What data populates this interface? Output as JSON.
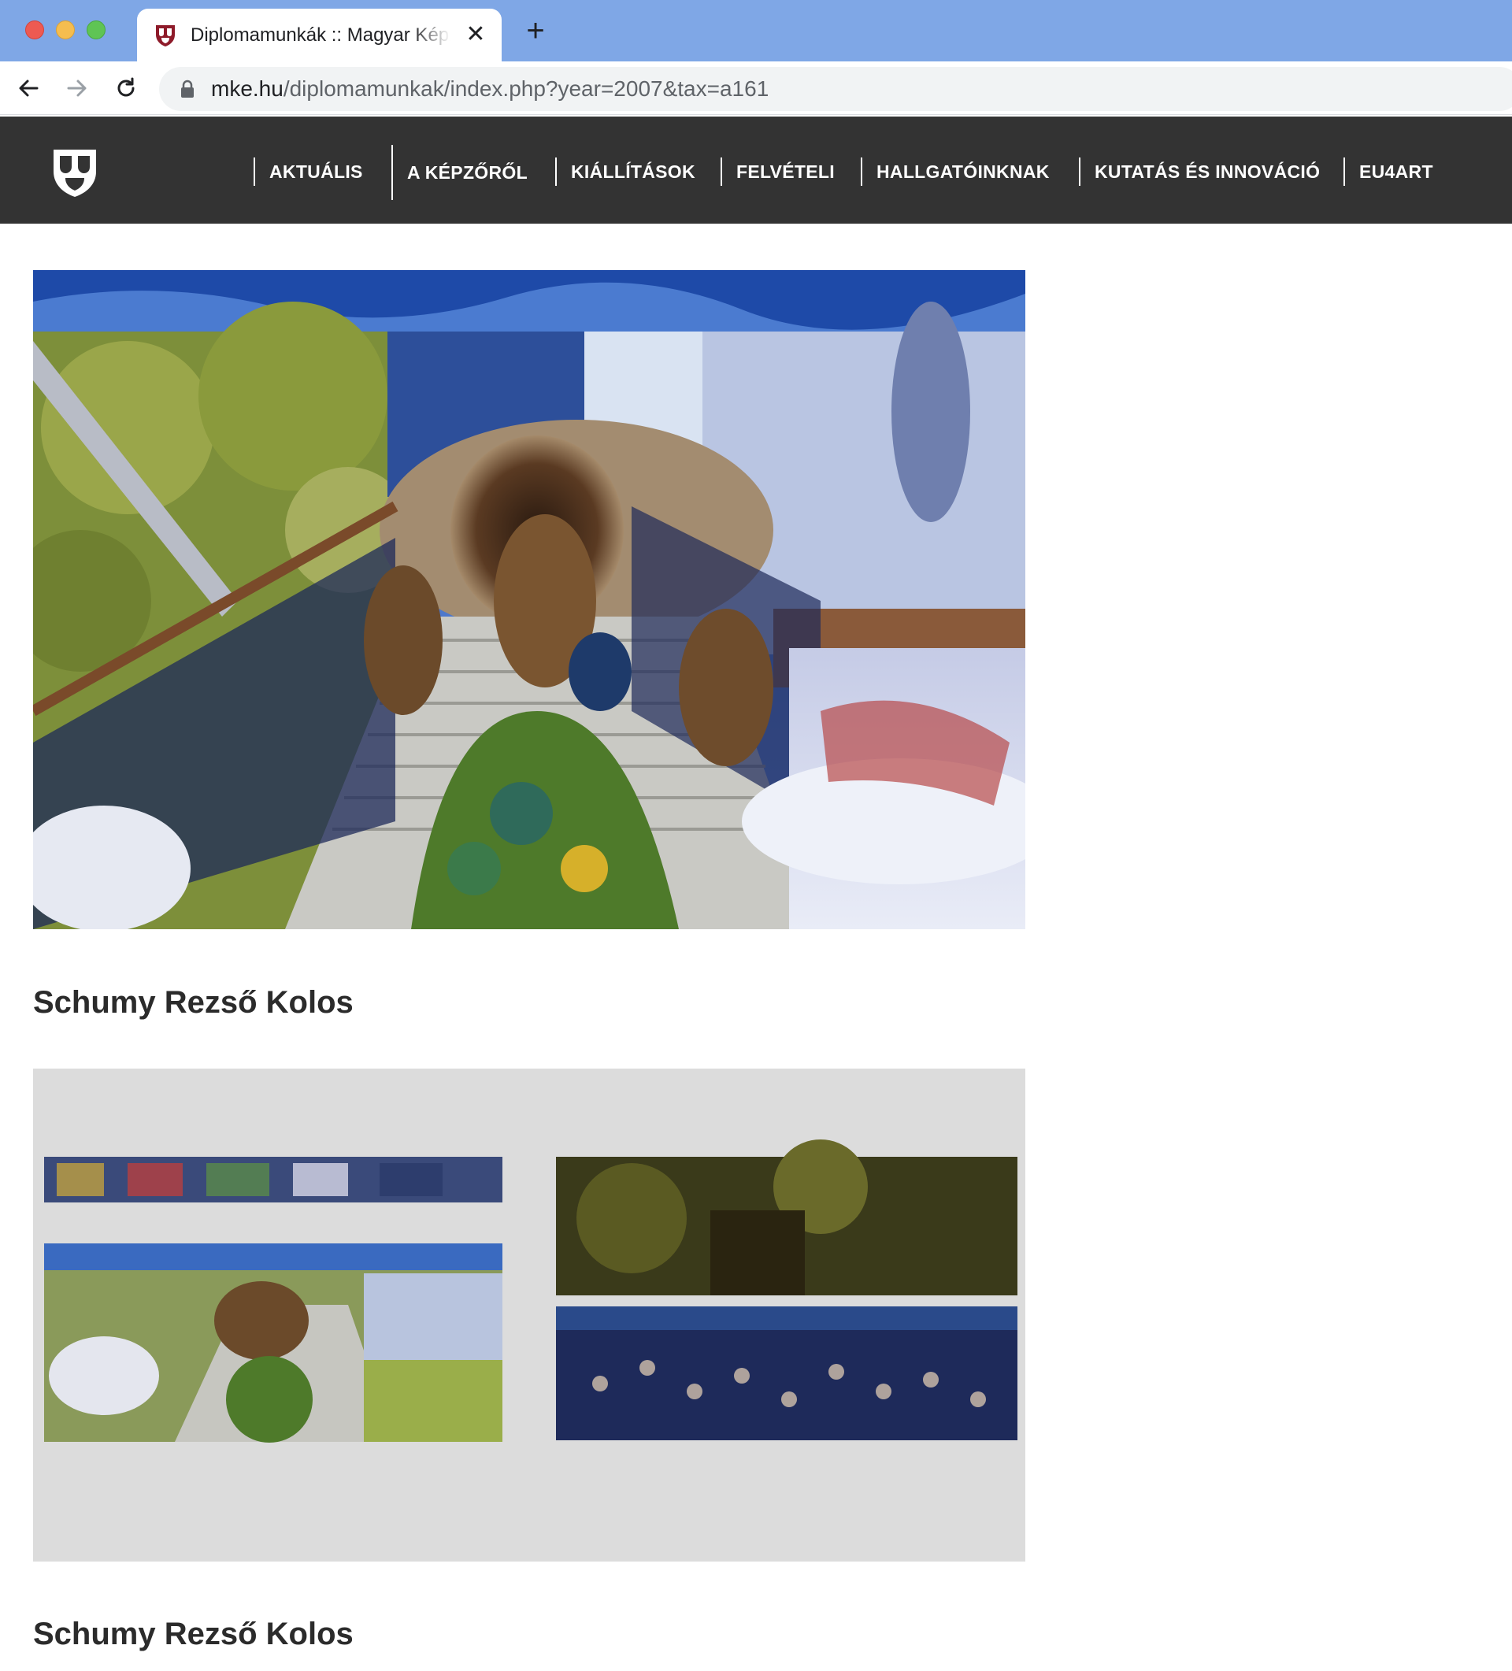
{
  "browser": {
    "tab_title": "Diplomamunkák :: Magyar Képzőművészeti Egyetem",
    "tab_close_glyph": "✕",
    "new_tab_glyph": "+",
    "url_host": "mke.hu",
    "url_path": "/diplomamunkak/index.php?year=2007&tax=a161",
    "icons": [
      "back-arrow-icon",
      "forward-arrow-icon",
      "reload-icon",
      "lock-icon",
      "shield-favicon-icon"
    ]
  },
  "site": {
    "nav": [
      {
        "label": "AKTUÁLIS"
      },
      {
        "label": "A KÉPZŐRŐL"
      },
      {
        "label": "KIÁLLÍTÁSOK"
      },
      {
        "label": "FELVÉTELI"
      },
      {
        "label": "HALLGATÓINKNAK"
      },
      {
        "label": "KUTATÁS ÉS INNOVÁCIÓ"
      },
      {
        "label": "EU4ART"
      }
    ],
    "colors": {
      "header_bg": "#333333",
      "nav_text": "#ffffff",
      "favicon_red": "#8e1b2a"
    }
  },
  "works": [
    {
      "author": "Schumy Rezső Kolos"
    },
    {
      "author": "Schumy Rezső Kolos"
    }
  ]
}
